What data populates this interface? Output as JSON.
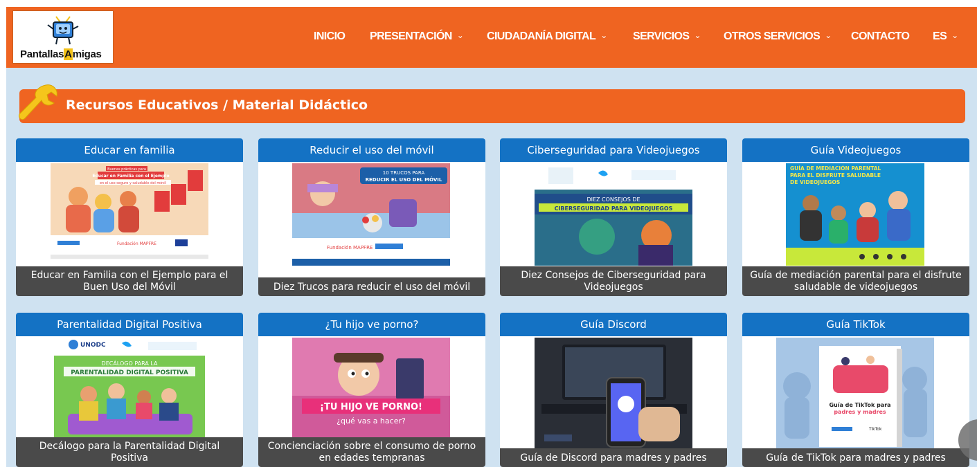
{
  "logo": {
    "prefix": "Pantallas",
    "highlight": "A",
    "suffix": "migas"
  },
  "nav": {
    "items": [
      {
        "label": "INICIO",
        "dropdown": false
      },
      {
        "label": "PRESENTACIÓN",
        "dropdown": true
      },
      {
        "label": "CIUDADANÍA DIGITAL",
        "dropdown": true
      },
      {
        "label": "SERVICIOS",
        "dropdown": true
      },
      {
        "label": "OTROS SERVICIOS",
        "dropdown": true
      },
      {
        "label": "CONTACTO",
        "dropdown": false
      },
      {
        "label": "ES",
        "dropdown": true
      }
    ]
  },
  "section": {
    "title": "Recursos Educativos / Material Didáctico",
    "icon": "wrench-icon"
  },
  "cards": [
    {
      "title": "Educar en familia",
      "caption": "Educar en Familia con el Ejemplo para el Buen Uso del Móvil",
      "img_text": [
        "Buenas prácticas para",
        "Educar en Familia con el Ejemplo",
        "en el uso seguro y saludable del móvil",
        "Fundación MAPFRE"
      ]
    },
    {
      "title": "Reducir el uso del móvil",
      "caption": "Diez Trucos para reducir el uso del móvil",
      "img_text": [
        "10 TRUCOS PARA",
        "REDUCIR EL USO DEL MÓVIL",
        "Fundación MAPFRE"
      ]
    },
    {
      "title": "Ciberseguridad para Videojuegos",
      "caption": "Diez Consejos de Ciberseguridad para Videojuegos",
      "img_text": [
        "DIEZ CONSEJOS DE",
        "CIBERSEGURIDAD PARA VIDEOJUEGOS"
      ]
    },
    {
      "title": "Guía Videojuegos",
      "caption": "Guía de mediación parental para el disfrute saludable de videojuegos",
      "img_text": [
        "GUÍA DE MEDIACIÓN PARENTAL",
        "PARA EL DISFRUTE SALUDABLE",
        "DE VIDEOJUEGOS"
      ]
    },
    {
      "title": "Parentalidad Digital Positiva",
      "caption": "Decálogo para la Parentalidad Digital Positiva",
      "img_text": [
        "UNODC",
        "DECÁLOGO PARA LA",
        "PARENTALIDAD DIGITAL POSITIVA"
      ]
    },
    {
      "title": "¿Tu hijo ve porno?",
      "caption": "Concienciación sobre el consumo de porno en edades tempranas",
      "img_text": [
        "¡TU HIJO VE PORNO!",
        "¿qué vas a hacer?"
      ]
    },
    {
      "title": "Guía Discord",
      "caption": "Guía de Discord para madres y padres",
      "img_text": []
    },
    {
      "title": "Guía TikTok",
      "caption": "Guía de TikTok para madres y padres",
      "img_text": [
        "Guía de TikTok para",
        "padres y madres",
        "TikTok"
      ]
    }
  ],
  "colors": {
    "nav": "#ef6421",
    "card_header": "#1472c4",
    "background": "#cfe2f1",
    "caption_bg": "#4a4a4a"
  }
}
